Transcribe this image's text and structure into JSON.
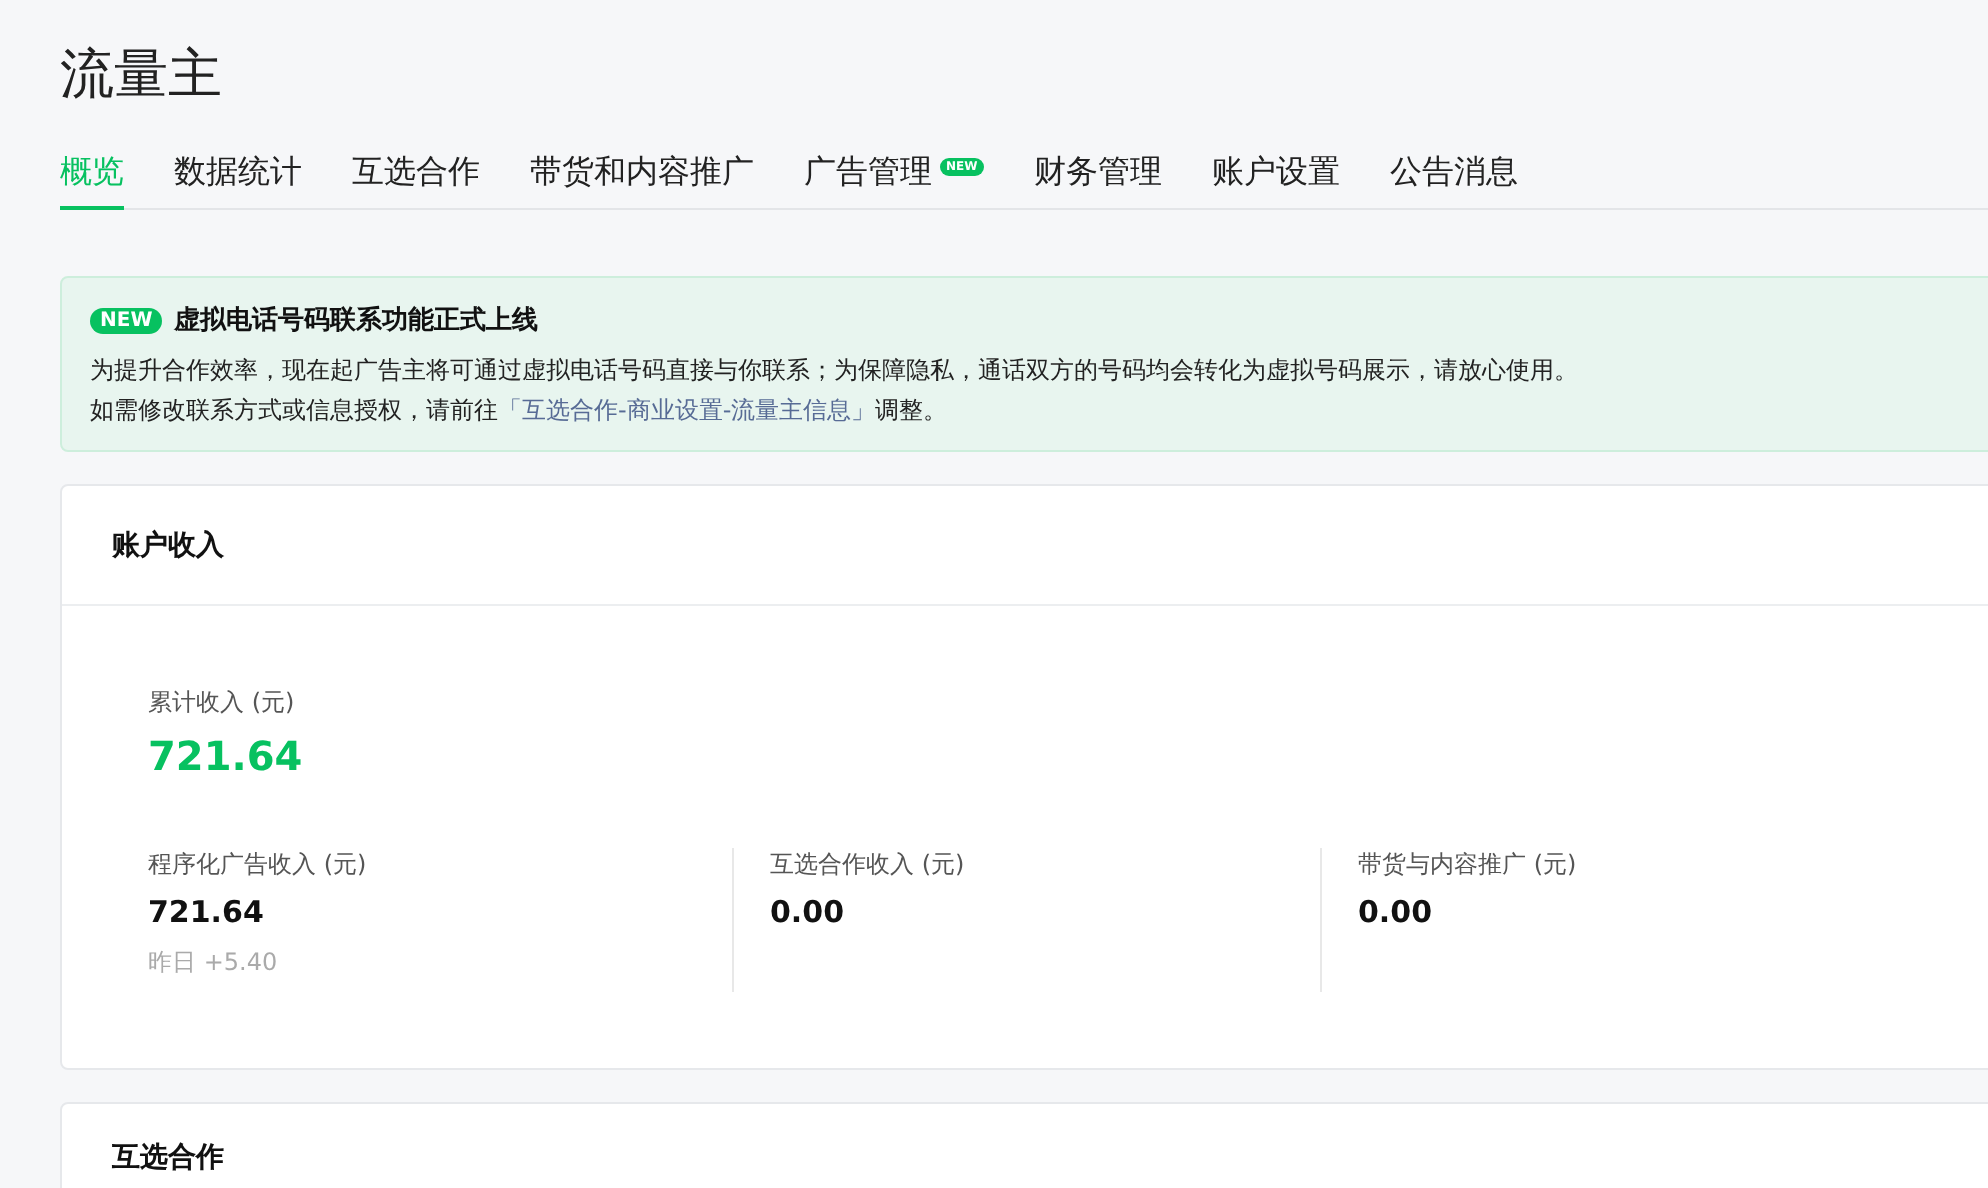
{
  "page_title": "流量主",
  "tabs": [
    {
      "label": "概览",
      "selected": true
    },
    {
      "label": "数据统计",
      "selected": false
    },
    {
      "label": "互选合作",
      "selected": false
    },
    {
      "label": "带货和内容推广",
      "selected": false
    },
    {
      "label": "广告管理",
      "selected": false,
      "badge": "NEW"
    },
    {
      "label": "财务管理",
      "selected": false
    },
    {
      "label": "账户设置",
      "selected": false
    },
    {
      "label": "公告消息",
      "selected": false
    }
  ],
  "notice": {
    "badge": "NEW",
    "title": "虚拟电话号码联系功能正式上线",
    "line_1": "为提升合作效率，现在起广告主将可通过虚拟电话号码直接与你联系；为保障隐私，通话双方的号码均会转化为虚拟号码展示，请放心使用。",
    "line_2_before": "如需修改联系方式或信息授权，请前往",
    "link": "「互选合作-商业设置-流量主信息」",
    "line_2_after": "调整。"
  },
  "income_card": {
    "title": "账户收入",
    "total": {
      "label": "累计收入 (元)",
      "value": "721.64"
    },
    "items": [
      {
        "label": "程序化广告收入 (元)",
        "value": "721.64",
        "note": "昨日 +5.40"
      },
      {
        "label": "互选合作收入 (元)",
        "value": "0.00"
      },
      {
        "label": "带货与内容推广 (元)",
        "value": "0.00"
      }
    ]
  },
  "next_card": {
    "title": "互选合作"
  }
}
